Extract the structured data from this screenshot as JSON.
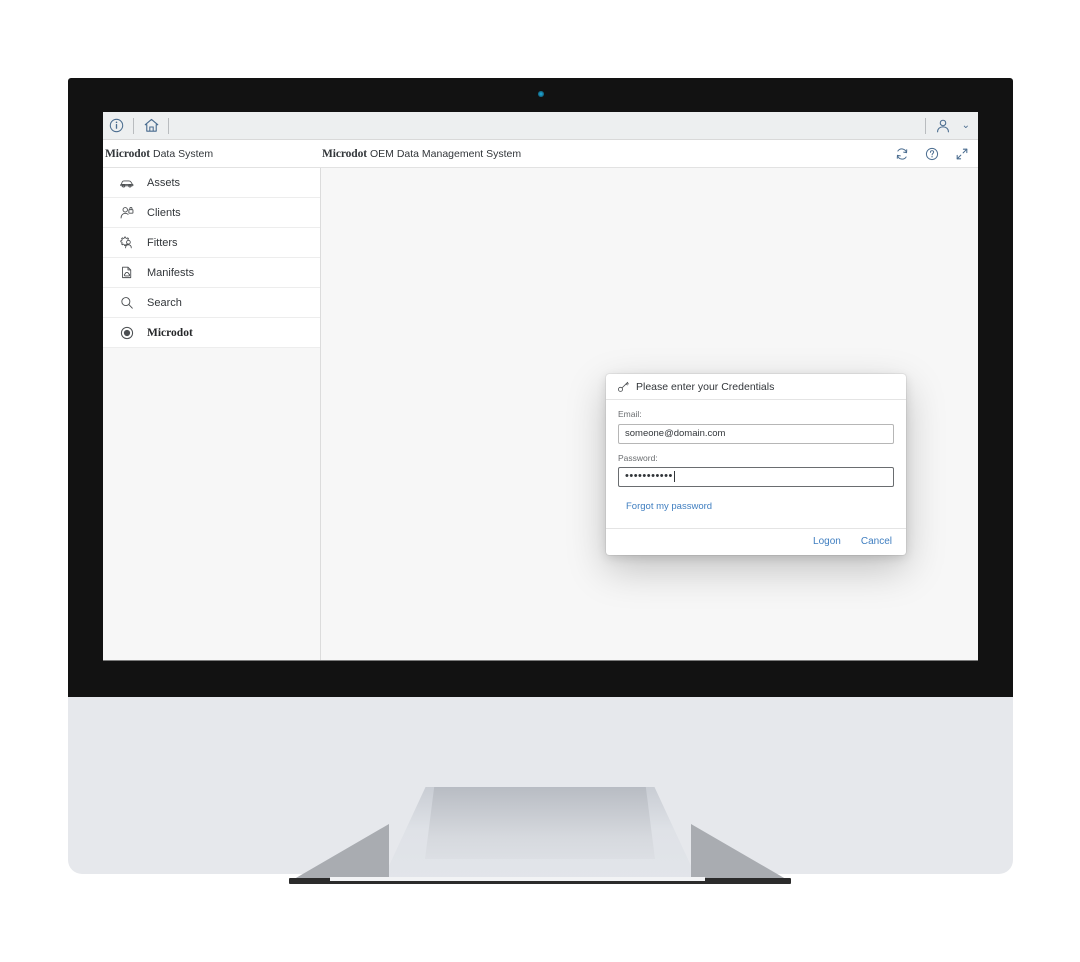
{
  "shellbar": {
    "info_icon": "info-icon",
    "home_icon": "home-icon",
    "user_icon": "user-avatar-icon",
    "user_chevron": "⌄"
  },
  "title_bar": {
    "sidebar_title_brand": "Microdot",
    "sidebar_title_rest": "Data System",
    "app_title_brand": "Microdot",
    "app_title_rest": "OEM Data Management System",
    "actions": [
      {
        "name": "refresh-icon",
        "tooltip": "Refresh"
      },
      {
        "name": "help-icon",
        "tooltip": "Help"
      },
      {
        "name": "fullscreen-icon",
        "tooltip": "Full Screen"
      }
    ]
  },
  "sidebar": {
    "items": [
      {
        "label": "Assets",
        "icon": "car-icon",
        "selected": false
      },
      {
        "label": "Clients",
        "icon": "person-lock-icon",
        "selected": false
      },
      {
        "label": "Fitters",
        "icon": "person-gear-icon",
        "selected": false
      },
      {
        "label": "Manifests",
        "icon": "document-cloud-icon",
        "selected": false
      },
      {
        "label": "Search",
        "icon": "search-icon",
        "selected": false
      },
      {
        "label": "Microdot",
        "icon": "radio-filled-icon",
        "selected": true
      }
    ]
  },
  "dialog": {
    "title": "Please enter your Credentials",
    "title_icon": "key-icon",
    "email_label": "Email:",
    "email_value": "someone@domain.com",
    "email_placeholder": "someone@domain.com",
    "password_label": "Password:",
    "password_masked": "•••••••••••",
    "password_length": 11,
    "forgot_link": "Forgot my password",
    "logon_label": "Logon",
    "cancel_label": "Cancel"
  },
  "colors": {
    "link_blue": "#3f7ec0",
    "shell_bg": "#edeff0",
    "content_bg": "#f7f7f7",
    "text": "#32363a",
    "label_gray": "#6a6d70",
    "icon_blue": "#4a6c8f",
    "webcam_dot": "#22b5e8",
    "bezel_black": "#121212",
    "chin_gray": "#e6e8ec"
  }
}
